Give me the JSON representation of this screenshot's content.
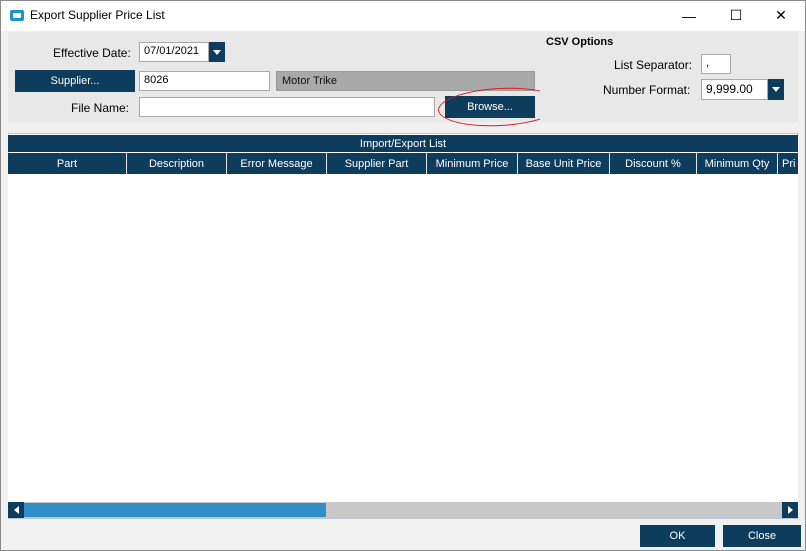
{
  "window": {
    "title": "Export Supplier Price List",
    "minimize_glyph": "—",
    "maximize_glyph": "☐",
    "close_glyph": "✕"
  },
  "form": {
    "effective_date_label": "Effective Date:",
    "effective_date_value": "07/01/2021",
    "supplier_button": "Supplier...",
    "supplier_id": "8026",
    "supplier_name": "Motor Trike",
    "file_name_label": "File Name:",
    "file_name_value": "",
    "browse_button": "Browse..."
  },
  "csv_options": {
    "heading": "CSV Options",
    "list_separator_label": "List Separator:",
    "list_separator_value": ",",
    "number_format_label": "Number Format:",
    "number_format_value": "9,999.00"
  },
  "grid": {
    "title": "Import/Export List",
    "columns": [
      "Part",
      "Description",
      "Error Message",
      "Supplier Part",
      "Minimum Price",
      "Base Unit Price",
      "Discount %",
      "Minimum Qty",
      "Pri"
    ]
  },
  "footer": {
    "ok_button": "OK",
    "close_button": "Close"
  },
  "colors": {
    "navy": "#0e3c5c",
    "scroll_thumb": "#2f8fc8",
    "annotation_red": "#e01b24"
  }
}
